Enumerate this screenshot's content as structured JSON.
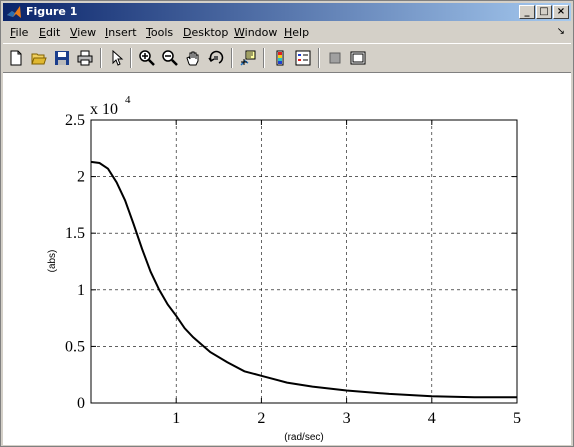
{
  "window": {
    "title": "Figure 1",
    "controls": [
      "_",
      "□",
      "×"
    ]
  },
  "menu": {
    "items": [
      {
        "id": "file",
        "label": "File",
        "u": "F",
        "rest": "ile"
      },
      {
        "id": "edit",
        "label": "Edit",
        "u": "E",
        "rest": "dit"
      },
      {
        "id": "view",
        "label": "View",
        "u": "V",
        "rest": "iew"
      },
      {
        "id": "insert",
        "label": "Insert",
        "u": "I",
        "rest": "nsert"
      },
      {
        "id": "tools",
        "label": "Tools",
        "u": "T",
        "rest": "ools"
      },
      {
        "id": "desktop",
        "label": "Desktop",
        "u": "D",
        "rest": "esktop"
      },
      {
        "id": "window",
        "label": "Window",
        "u": "W",
        "rest": "indow"
      },
      {
        "id": "help",
        "label": "Help",
        "u": "H",
        "rest": "elp"
      }
    ],
    "dock_glyph": "↘"
  },
  "toolbar": {
    "buttons": [
      "new-figure-icon",
      "open-file-icon",
      "save-icon",
      "print-icon",
      "select-arrow-icon",
      "zoom-in-icon",
      "zoom-out-icon",
      "pan-hand-icon",
      "rotate-3d-icon",
      "data-cursor-icon",
      "colorbar-icon",
      "legend-icon",
      "hide-plot-tools-icon",
      "show-plot-tools-icon"
    ]
  },
  "chart_data": {
    "type": "line",
    "title": "",
    "xlabel": "(rad/sec)",
    "ylabel": "(abs)",
    "exponent_label": "x 10",
    "exponent_power": "4",
    "xlim": [
      0,
      5
    ],
    "ylim": [
      0,
      2.5
    ],
    "xticks": [
      "1",
      "2",
      "3",
      "4",
      "5"
    ],
    "yticks": [
      "0",
      "0.5",
      "1",
      "1.5",
      "2",
      "2.5"
    ],
    "grid": true,
    "line_color": "#000000",
    "series": [
      {
        "x": [
          0.0,
          0.1,
          0.2,
          0.3,
          0.4,
          0.5,
          0.6,
          0.7,
          0.8,
          0.9,
          1.0,
          1.1,
          1.2,
          1.4,
          1.6,
          1.8,
          2.0,
          2.3,
          2.6,
          3.0,
          3.5,
          4.0,
          4.5,
          5.0
        ],
        "y": [
          2.13,
          2.12,
          2.07,
          1.95,
          1.79,
          1.58,
          1.36,
          1.16,
          1.0,
          0.87,
          0.77,
          0.66,
          0.58,
          0.45,
          0.36,
          0.28,
          0.24,
          0.18,
          0.145,
          0.11,
          0.08,
          0.06,
          0.05,
          0.05
        ]
      }
    ]
  }
}
